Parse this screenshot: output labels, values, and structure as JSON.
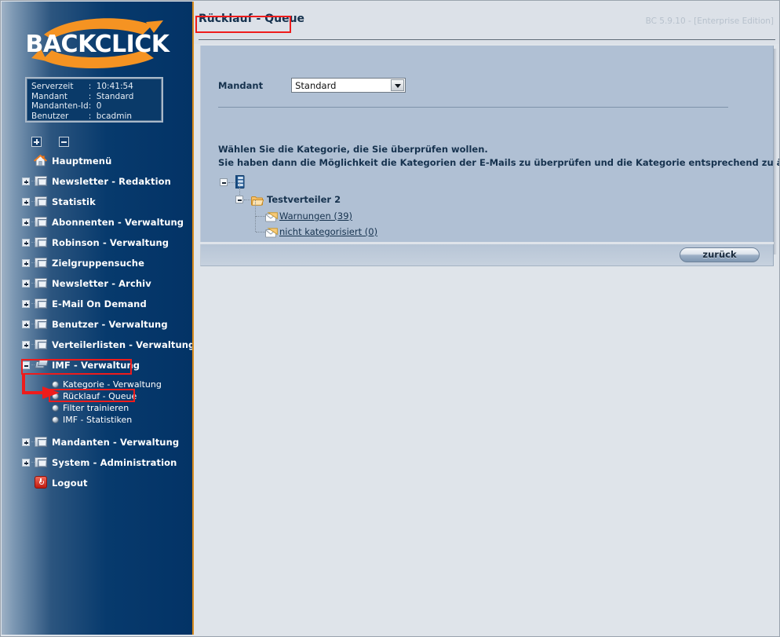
{
  "header": {
    "title": "Rücklauf - Queue",
    "version": "BC 5.9.10 - [Enterprise Edition]"
  },
  "sidebar": {
    "logo_text": "BACKCLICK",
    "info": {
      "rows": [
        {
          "key": "Serverzeit",
          "sep": ":",
          "value": "10:41:54"
        },
        {
          "key": "Mandant",
          "sep": ":",
          "value": "Standard"
        },
        {
          "key": "Mandanten-Id",
          "sep": ":",
          "value": "0"
        },
        {
          "key": "Benutzer",
          "sep": ":",
          "value": "bcadmin"
        }
      ]
    },
    "expand_all_label": "+",
    "collapse_all_label": "-",
    "items": [
      {
        "label": "Hauptmenü",
        "icon": "home-icon",
        "expandable": false
      },
      {
        "label": "Newsletter - Redaktion",
        "icon": "folder-icon",
        "expandable": true
      },
      {
        "label": "Statistik",
        "icon": "folder-icon",
        "expandable": true
      },
      {
        "label": "Abonnenten - Verwaltung",
        "icon": "folder-icon",
        "expandable": true
      },
      {
        "label": "Robinson - Verwaltung",
        "icon": "folder-icon",
        "expandable": true
      },
      {
        "label": "Zielgruppensuche",
        "icon": "folder-icon",
        "expandable": true
      },
      {
        "label": "Newsletter - Archiv",
        "icon": "folder-icon",
        "expandable": true
      },
      {
        "label": "E-Mail On Demand",
        "icon": "folder-icon",
        "expandable": true
      },
      {
        "label": "Benutzer - Verwaltung",
        "icon": "folder-icon",
        "expandable": true
      },
      {
        "label": "Verteilerlisten - Verwaltung",
        "icon": "folder-icon",
        "expandable": true
      },
      {
        "label": "IMF - Verwaltung",
        "icon": "imf-icon",
        "expandable": true,
        "expanded": true
      },
      {
        "label": "Mandanten - Verwaltung",
        "icon": "folder-icon",
        "expandable": true
      },
      {
        "label": "System - Administration",
        "icon": "folder-icon",
        "expandable": true
      },
      {
        "label": "Logout",
        "icon": "power-icon",
        "expandable": false
      }
    ],
    "imf_subitems": [
      {
        "label": "Kategorie - Verwaltung"
      },
      {
        "label": "Rücklauf - Queue",
        "highlighted": true
      },
      {
        "label": "Filter trainieren"
      },
      {
        "label": "IMF - Statistiken"
      }
    ]
  },
  "main": {
    "mandant_label": "Mandant",
    "mandant_value": "Standard",
    "instruction_line1": "Wählen Sie die Kategorie, die Sie überprüfen wollen.",
    "instruction_line2": "Sie haben dann die Möglichkeit die Kategorien der E-Mails zu überprüfen und die Kategorie entsprechend zu ändern.",
    "tree": {
      "root": {
        "label": "",
        "icon": "server-icon"
      },
      "group": {
        "label": "Testverteiler 2",
        "icon": "folder-open-icon"
      },
      "leaves": [
        {
          "label": "Warnungen (39)",
          "icon": "mail-icon"
        },
        {
          "label": "nicht kategorisiert (0)",
          "icon": "mail-icon"
        }
      ]
    },
    "back_button": "zurück"
  },
  "colors": {
    "sidebar_dark": "#033366",
    "sidebar_light": "#9fb2c6",
    "accent_orange": "#d98c1d",
    "panel_bg": "#b0c0d4",
    "topbar_bg": "#dce1e8",
    "annotation_red": "#ee1c1c",
    "title_text": "#16324e"
  }
}
